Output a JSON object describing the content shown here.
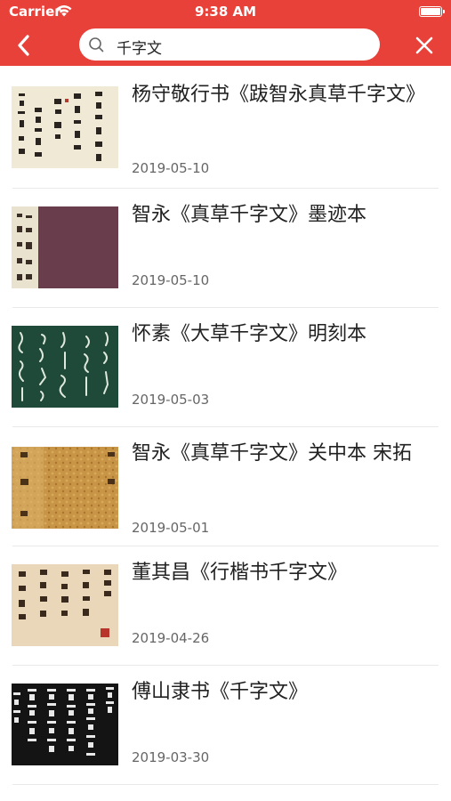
{
  "status_bar": {
    "carrier": "Carrier",
    "time": "9:38 AM"
  },
  "nav": {
    "search_value": "千字文"
  },
  "icons": {
    "back": "chevron-left-icon",
    "search": "search-icon",
    "close": "close-icon"
  },
  "colors": {
    "accent": "#e8413a"
  },
  "items": [
    {
      "title": "杨守敬行书《跋智永真草千字文》",
      "date": "2019-05-10"
    },
    {
      "title": "智永《真草千字文》墨迹本",
      "date": "2019-05-10"
    },
    {
      "title": "怀素《大草千字文》明刻本",
      "date": "2019-05-03"
    },
    {
      "title": "智永《真草千字文》关中本 宋拓",
      "date": "2019-05-01"
    },
    {
      "title": "董其昌《行楷书千字文》",
      "date": "2019-04-26"
    },
    {
      "title": "傅山隶书《千字文》",
      "date": "2019-03-30"
    }
  ]
}
